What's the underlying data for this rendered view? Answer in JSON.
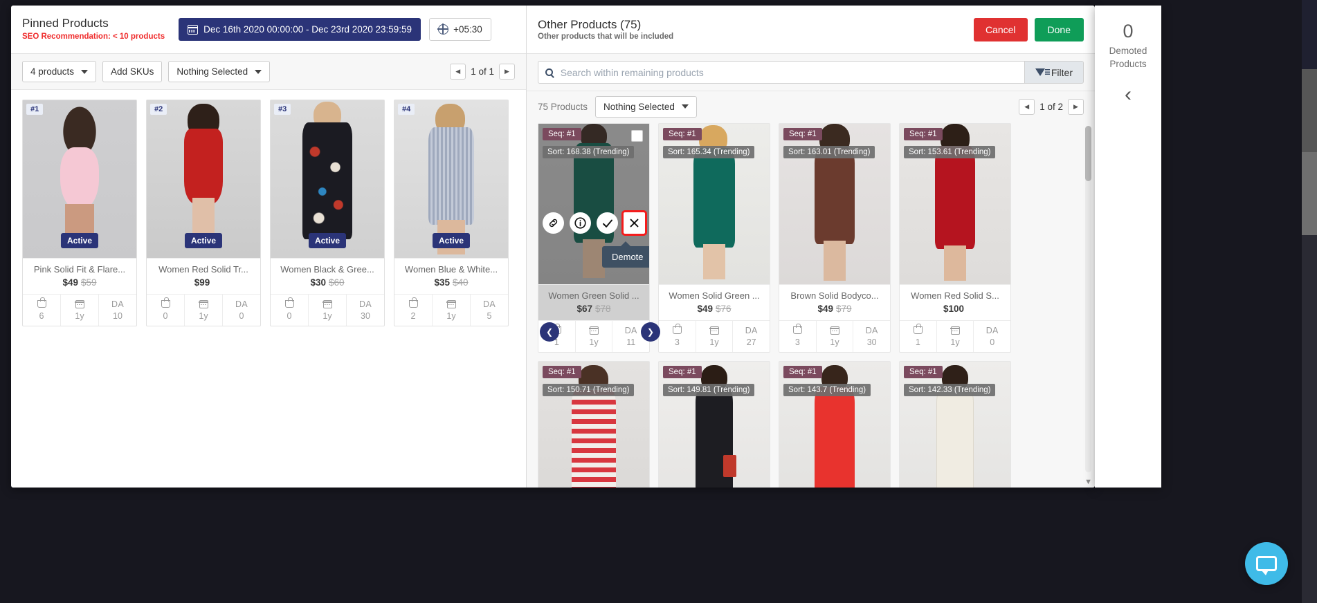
{
  "left_panel": {
    "title": "Pinned Products",
    "seo_recommendation": "SEO Recommendation: < 10 products",
    "date_range": "Dec 16th 2020 00:00:00 - Dec 23rd 2020 23:59:59",
    "timezone": "+05:30",
    "toolbar": {
      "product_count_label": "4 products",
      "add_skus_label": "Add SKUs",
      "selection_label": "Nothing Selected"
    },
    "pager": {
      "label": "1 of 1",
      "prev": "◀",
      "next": "▶"
    },
    "products": [
      {
        "rank": "#1",
        "status": "Active",
        "title": "Pink Solid Fit & Flare...",
        "price": "$49",
        "strike_price": "$59",
        "stats": [
          {
            "icon": "bag-icon",
            "value": "6"
          },
          {
            "icon": "calendar-icon",
            "value": "1y"
          },
          {
            "icon": "da-label",
            "label": "DA",
            "value": "10"
          }
        ]
      },
      {
        "rank": "#2",
        "status": "Active",
        "title": "Women Red Solid Tr...",
        "price": "$99",
        "strike_price": "",
        "stats": [
          {
            "icon": "bag-icon",
            "value": "0"
          },
          {
            "icon": "calendar-icon",
            "value": "1y"
          },
          {
            "icon": "da-label",
            "label": "DA",
            "value": "0"
          }
        ]
      },
      {
        "rank": "#3",
        "status": "Active",
        "title": "Women Black & Gree...",
        "price": "$30",
        "strike_price": "$60",
        "stats": [
          {
            "icon": "bag-icon",
            "value": "0"
          },
          {
            "icon": "calendar-icon",
            "value": "1y"
          },
          {
            "icon": "da-label",
            "label": "DA",
            "value": "30"
          }
        ]
      },
      {
        "rank": "#4",
        "status": "Active",
        "title": "Women Blue & White...",
        "price": "$35",
        "strike_price": "$40",
        "stats": [
          {
            "icon": "bag-icon",
            "value": "2"
          },
          {
            "icon": "calendar-icon",
            "value": "1y"
          },
          {
            "icon": "da-label",
            "label": "DA",
            "value": "5"
          }
        ]
      }
    ]
  },
  "right_panel": {
    "title": "Other Products (75)",
    "subtitle": "Other products that will be included",
    "cancel_label": "Cancel",
    "done_label": "Done",
    "search": {
      "placeholder": "Search within remaining products",
      "value": ""
    },
    "filter_label": "Filter",
    "count_label": "75 Products",
    "selection_label": "Nothing Selected",
    "pager": {
      "label": "1 of 2",
      "prev": "◀",
      "next": "▶"
    },
    "hover_tooltip": "Demote",
    "hover_actions": [
      "link-icon",
      "info-icon",
      "check-icon",
      "close-icon"
    ],
    "products": [
      {
        "seq": "Seq: #1",
        "sort": "Sort: 168.38 (Trending)",
        "title": "Women Green Solid ...",
        "price": "$67",
        "strike_price": "$78",
        "stats": [
          {
            "icon": "bag-icon",
            "value": "1"
          },
          {
            "icon": "calendar-icon",
            "value": "1y"
          },
          {
            "icon": "da-label",
            "label": "DA",
            "value": "11"
          }
        ]
      },
      {
        "seq": "Seq: #1",
        "sort": "Sort: 165.34 (Trending)",
        "title": "Women Solid Green ...",
        "price": "$49",
        "strike_price": "$76",
        "stats": [
          {
            "icon": "bag-icon",
            "value": "3"
          },
          {
            "icon": "calendar-icon",
            "value": "1y"
          },
          {
            "icon": "da-label",
            "label": "DA",
            "value": "27"
          }
        ]
      },
      {
        "seq": "Seq: #1",
        "sort": "Sort: 163.01 (Trending)",
        "title": "Brown Solid Bodyco...",
        "price": "$49",
        "strike_price": "$79",
        "stats": [
          {
            "icon": "bag-icon",
            "value": "3"
          },
          {
            "icon": "calendar-icon",
            "value": "1y"
          },
          {
            "icon": "da-label",
            "label": "DA",
            "value": "30"
          }
        ]
      },
      {
        "seq": "Seq: #1",
        "sort": "Sort: 153.61 (Trending)",
        "title": "Women Red Solid S...",
        "price": "$100",
        "strike_price": "",
        "stats": [
          {
            "icon": "bag-icon",
            "value": "1"
          },
          {
            "icon": "calendar-icon",
            "value": "1y"
          },
          {
            "icon": "da-label",
            "label": "DA",
            "value": "0"
          }
        ]
      },
      {
        "seq": "Seq: #1",
        "sort": "Sort: 150.71 (Trending)",
        "title": "",
        "price": "",
        "strike_price": "",
        "stats": []
      },
      {
        "seq": "Seq: #1",
        "sort": "Sort: 149.81 (Trending)",
        "title": "",
        "price": "",
        "strike_price": "",
        "stats": []
      },
      {
        "seq": "Seq: #1",
        "sort": "Sort: 143.7 (Trending)",
        "title": "",
        "price": "",
        "strike_price": "",
        "stats": []
      },
      {
        "seq": "Seq: #1",
        "sort": "Sort: 142.33 (Trending)",
        "title": "",
        "price": "",
        "strike_price": "",
        "stats": []
      }
    ]
  },
  "demoted_rail": {
    "count": "0",
    "label_line1": "Demoted",
    "label_line2": "Products",
    "collapse_icon": "‹"
  },
  "colors": {
    "primary": "#2b3478",
    "danger": "#e03131",
    "success": "#0f9d58",
    "seq_badge": "#7b4a5e",
    "highlight_outline": "#f51b1b",
    "chat": "#3fbbe8"
  }
}
